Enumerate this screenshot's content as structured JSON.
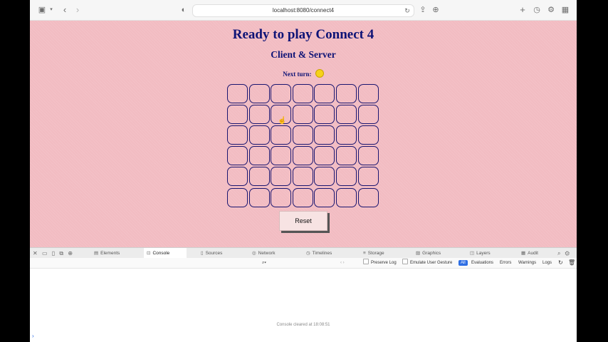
{
  "browser": {
    "url": "localhost:8080/connect4",
    "icons": {
      "sidebar": "sidebar-icon",
      "back": "chevron-left-icon",
      "forward": "chevron-right-icon",
      "privacy": "shield-icon",
      "reload": "reload-icon",
      "share": "share-icon",
      "download": "download-icon",
      "new_tab": "plus-icon",
      "history": "clock-icon",
      "settings": "gear-icon",
      "tabs": "grid-icon"
    }
  },
  "page": {
    "title": "Ready to play Connect 4",
    "subtitle": "Client & Server",
    "turn_label": "Next turn:",
    "turn_color": "#f6d21a",
    "board": {
      "columns": 7,
      "rows": 6
    },
    "reset_label": "Reset",
    "colors": {
      "background": "#f2bcc2",
      "heading": "#0e1376",
      "cell_border": "#1a1570"
    }
  },
  "devtools": {
    "tabs": [
      {
        "label": "Elements",
        "icon": "elements-icon"
      },
      {
        "label": "Console",
        "icon": "console-icon",
        "active": true
      },
      {
        "label": "Sources",
        "icon": "document-icon"
      },
      {
        "label": "Network",
        "icon": "network-icon"
      },
      {
        "label": "Timelines",
        "icon": "timer-icon"
      },
      {
        "label": "Storage",
        "icon": "database-icon"
      },
      {
        "label": "Graphics",
        "icon": "image-icon"
      },
      {
        "label": "Layers",
        "icon": "layers-icon"
      },
      {
        "label": "Audit",
        "icon": "audit-icon"
      }
    ],
    "filter": {
      "preserve_log": "Preserve Log",
      "emulate_gesture": "Emulate User Gesture",
      "levels": [
        "All",
        "Evaluations",
        "Errors",
        "Warnings",
        "Logs"
      ]
    },
    "console_message": "Console cleared at 18:08:51",
    "prompt": "›"
  }
}
